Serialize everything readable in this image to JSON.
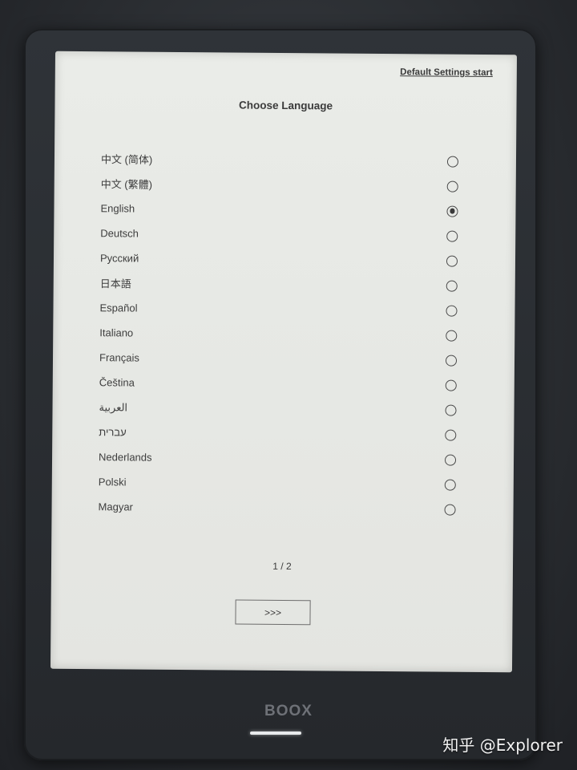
{
  "screen": {
    "default_settings_link": "Default Settings start",
    "title": "Choose Language",
    "languages": [
      {
        "label": "中文 (简体)",
        "selected": false
      },
      {
        "label": "中文 (繁體)",
        "selected": false
      },
      {
        "label": "English",
        "selected": true
      },
      {
        "label": "Deutsch",
        "selected": false
      },
      {
        "label": "Русский",
        "selected": false
      },
      {
        "label": "日本語",
        "selected": false
      },
      {
        "label": "Español",
        "selected": false
      },
      {
        "label": "Italiano",
        "selected": false
      },
      {
        "label": "Français",
        "selected": false
      },
      {
        "label": "Čeština",
        "selected": false
      },
      {
        "label": "العربية",
        "selected": false
      },
      {
        "label": "עברית",
        "selected": false
      },
      {
        "label": "Nederlands",
        "selected": false
      },
      {
        "label": "Polski",
        "selected": false
      },
      {
        "label": "Magyar",
        "selected": false
      }
    ],
    "page_indicator": "1 / 2",
    "next_button_label": ">>>"
  },
  "device": {
    "brand": "BOOX"
  },
  "watermark": "知乎 @Explorer"
}
